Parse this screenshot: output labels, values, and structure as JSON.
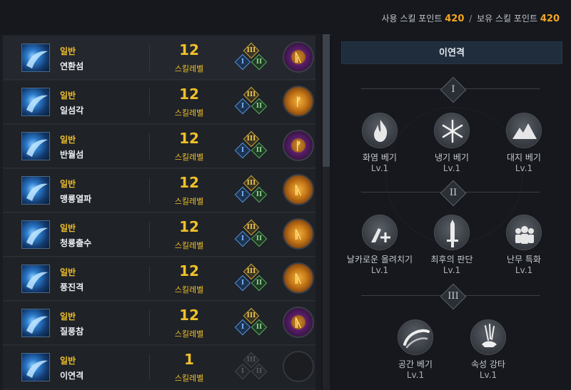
{
  "points": {
    "used_label": "사용 스킬 포인트",
    "used_value": "420",
    "separator": "/",
    "owned_label": "보유 스킬 포인트",
    "owned_value": "420"
  },
  "skills": [
    {
      "type": "일반",
      "name": "연환섬",
      "level": "12",
      "level_label": "스킬레벨",
      "rune": "purple",
      "rune_glyph": "ᚣ",
      "tripods": {
        "t3": "III",
        "t1": "I",
        "t2": "II"
      }
    },
    {
      "type": "일반",
      "name": "일섬각",
      "level": "12",
      "level_label": "스킬레벨",
      "rune": "orange",
      "rune_glyph": "ᚠ",
      "tripods": {
        "t3": "III",
        "t1": "I",
        "t2": "II"
      }
    },
    {
      "type": "일반",
      "name": "반월섬",
      "level": "12",
      "level_label": "스킬레벨",
      "rune": "purple",
      "rune_glyph": "ᚠ",
      "tripods": {
        "t3": "III",
        "t1": "I",
        "t2": "II"
      }
    },
    {
      "type": "일반",
      "name": "맹룡열파",
      "level": "12",
      "level_label": "스킬레벨",
      "rune": "orange",
      "rune_glyph": "ᚣ",
      "tripods": {
        "t3": "III",
        "t1": "I",
        "t2": "II"
      }
    },
    {
      "type": "일반",
      "name": "청룡출수",
      "level": "12",
      "level_label": "스킬레벨",
      "rune": "orange",
      "rune_glyph": "ᚣ",
      "tripods": {
        "t3": "III",
        "t1": "I",
        "t2": "II"
      }
    },
    {
      "type": "일반",
      "name": "풍진격",
      "level": "12",
      "level_label": "스킬레벨",
      "rune": "orange",
      "rune_glyph": "ᚣ",
      "tripods": {
        "t3": "III",
        "t1": "I",
        "t2": "II"
      }
    },
    {
      "type": "일반",
      "name": "질풍참",
      "level": "12",
      "level_label": "스킬레벨",
      "rune": "purple",
      "rune_glyph": "ᚣ",
      "tripods": {
        "t3": "III",
        "t1": "I",
        "t2": "II"
      }
    },
    {
      "type": "일반",
      "name": "이연격",
      "level": "1",
      "level_label": "스킬레벨",
      "rune": "empty",
      "rune_glyph": "",
      "tripods": {
        "t3": "III",
        "t1": "I",
        "t2": "II"
      }
    }
  ],
  "detail": {
    "title": "이연격",
    "tiers": [
      {
        "numeral": "I",
        "tripods": [
          {
            "name": "화염 베기",
            "level": "Lv.1",
            "icon": "flame-icon"
          },
          {
            "name": "냉기 베기",
            "level": "Lv.1",
            "icon": "snowflake-icon"
          },
          {
            "name": "대지 베기",
            "level": "Lv.1",
            "icon": "mountain-icon"
          }
        ]
      },
      {
        "numeral": "II",
        "tripods": [
          {
            "name": "날카로운 올려치기",
            "level": "Lv.1",
            "icon": "uppercut-icon"
          },
          {
            "name": "최후의 판단",
            "level": "Lv.1",
            "icon": "sword-icon"
          },
          {
            "name": "난무 특화",
            "level": "Lv.1",
            "icon": "crowd-icon"
          }
        ]
      },
      {
        "numeral": "III",
        "tripods": [
          {
            "name": "공간 베기",
            "level": "Lv.1",
            "icon": "space-slash-icon"
          },
          {
            "name": "속성 강타",
            "level": "Lv.1",
            "icon": "impact-icon"
          }
        ]
      }
    ]
  }
}
